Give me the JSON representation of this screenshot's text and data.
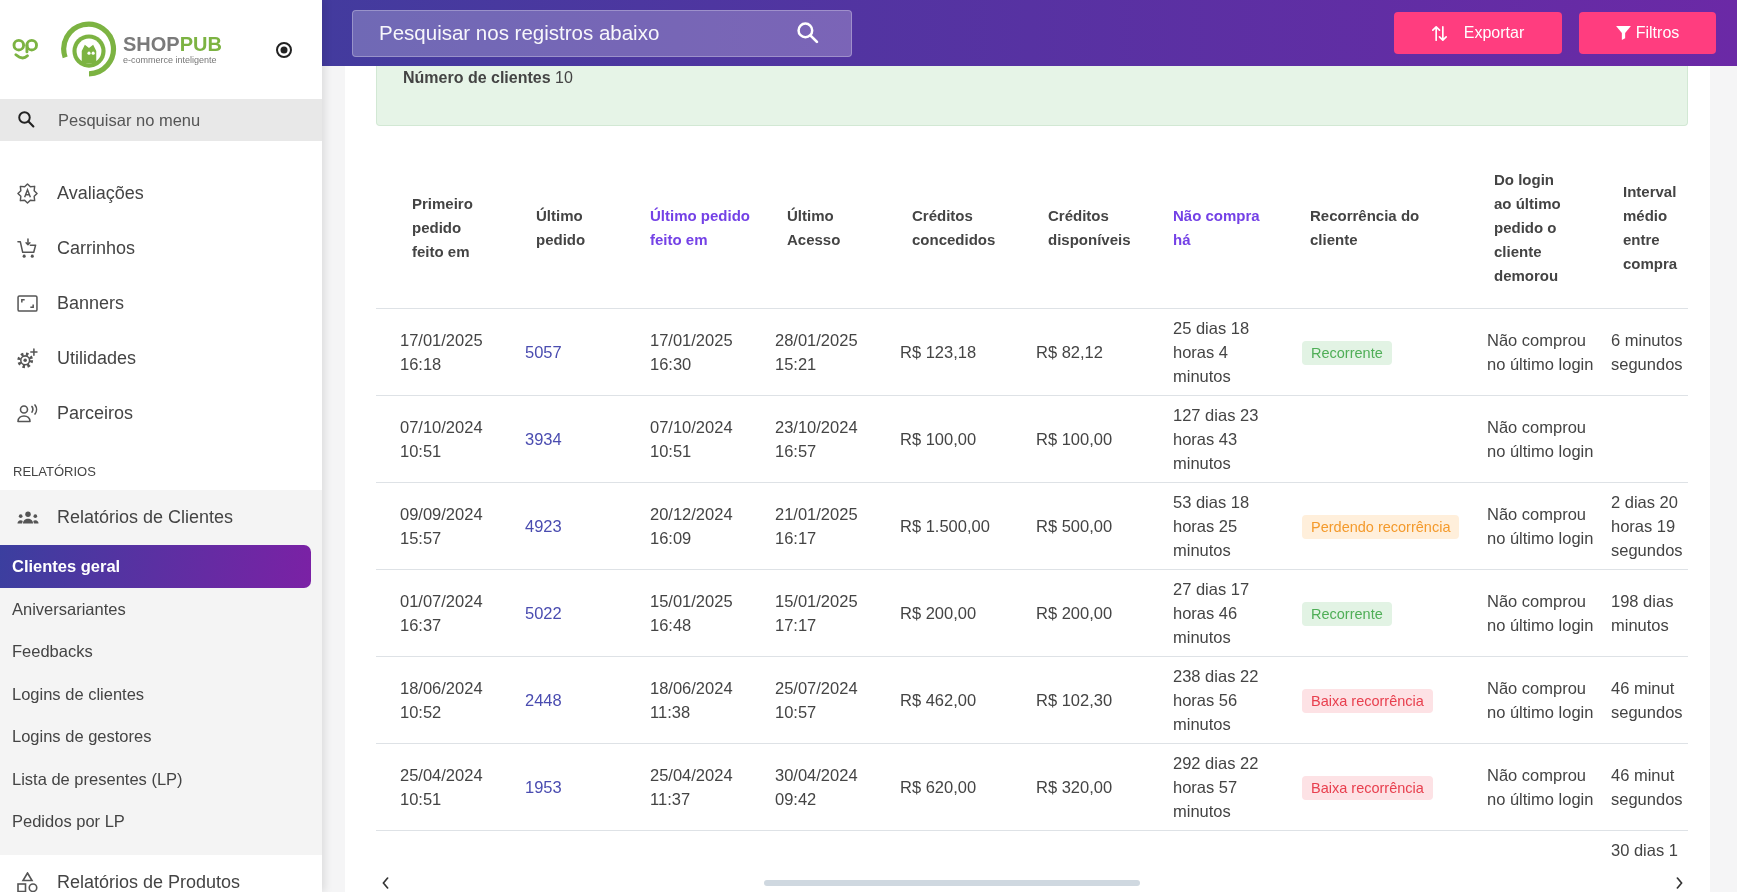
{
  "sidebar": {
    "wordmark": [
      {
        "text": "SHOP",
        "color": "#7a7a7a"
      },
      {
        "text": "PUB",
        "color": "#7cb342"
      }
    ],
    "tagline": "e-commerce inteligente",
    "search": {
      "placeholder": "Pesquisar no menu"
    },
    "items": [
      {
        "label": "Avaliações",
        "selected": false
      },
      {
        "label": "Carrinhos",
        "selected": false
      },
      {
        "label": "Banners",
        "selected": false
      },
      {
        "label": "Utilidades",
        "selected": false
      },
      {
        "label": "Parceiros",
        "selected": false
      }
    ],
    "section_title": "RELATÓRIOS",
    "groups": [
      {
        "label": "Relatórios de Clientes",
        "expanded": true,
        "children": [
          {
            "label": "Clientes geral",
            "selected": true
          },
          {
            "label": "Aniversariantes",
            "selected": false
          },
          {
            "label": "Feedbacks",
            "selected": false
          },
          {
            "label": "Logins de clientes",
            "selected": false
          },
          {
            "label": "Logins de gestores",
            "selected": false
          },
          {
            "label": "Lista de presentes (LP)",
            "selected": false
          },
          {
            "label": "Pedidos por LP",
            "selected": false
          }
        ]
      },
      {
        "label": "Relatórios de Produtos",
        "expanded": false
      }
    ]
  },
  "topbar": {
    "search": {
      "placeholder": "Pesquisar nos registros abaixo"
    },
    "buttons": [
      {
        "label": "Exportar"
      },
      {
        "label": "Filtros"
      }
    ]
  },
  "summary": "**Número de clientes** 10",
  "table": {
    "columns": [
      {
        "label": "Primeiro pedido feito em",
        "sortable": false
      },
      {
        "label": "Último pedido",
        "sortable": false
      },
      {
        "label": "Último pedido feito em",
        "sortable": true
      },
      {
        "label": "Último Acesso",
        "sortable": false
      },
      {
        "label": "Créditos concedidos",
        "sortable": false
      },
      {
        "label": "Créditos disponíveis",
        "sortable": false
      },
      {
        "label": "Não compra há",
        "sortable": true
      },
      {
        "label": "Recorrência do cliente",
        "sortable": false
      },
      {
        "label": "Do login ao último pedido o cliente demorou",
        "sortable": false
      },
      {
        "label": "Interval médio entre compra",
        "sortable": false
      }
    ],
    "rows": [
      {
        "first_order": "17/01/2025 16:18",
        "last_order": "5057",
        "last_order_date": "17/01/2025 16:30",
        "last_access": "28/01/2025 15:21",
        "credits_granted": "R$ 123,18",
        "credits_available": "R$ 82,12",
        "not_buying_for": "25 dias 18 horas 4 minutos",
        "recurrence": {
          "label": "Recorrente",
          "kind": "success"
        },
        "login_to_order": "Não comprou no último login",
        "column_10": "6 minutos segundos"
      },
      {
        "first_order": "07/10/2024 10:51",
        "last_order": "3934",
        "last_order_date": "07/10/2024 10:51",
        "last_access": "23/10/2024 16:57",
        "credits_granted": "R$ 100,00",
        "credits_available": "R$ 100,00",
        "not_buying_for": "127 dias 23 horas 43 minutos",
        "login_to_order": "Não comprou no último login"
      },
      {
        "first_order": "09/09/2024 15:57",
        "last_order": "4923",
        "last_order_date": "20/12/2024 16:09",
        "last_access": "21/01/2025 16:17",
        "credits_granted": "R$ 1.500,00",
        "credits_available": "R$ 500,00",
        "not_buying_for": "53 dias 18 horas 25 minutos",
        "recurrence": {
          "label": "Perdendo recorrência",
          "kind": "warning"
        },
        "login_to_order": "Não comprou no último login",
        "column_10": "2 dias 20 horas 19 segundos"
      },
      {
        "first_order": "01/07/2024 16:37",
        "last_order": "5022",
        "last_order_date": "15/01/2025 16:48",
        "last_access": "15/01/2025 17:17",
        "credits_granted": "R$ 200,00",
        "credits_available": "R$ 200,00",
        "not_buying_for": "27 dias 17 horas 46 minutos",
        "recurrence": {
          "label": "Recorrente",
          "kind": "success"
        },
        "login_to_order": "Não comprou no último login",
        "column_10": "198 dias minutos"
      },
      {
        "first_order": "18/06/2024 10:52",
        "last_order": "2448",
        "last_order_date": "18/06/2024 11:38",
        "last_access": "25/07/2024 10:57",
        "credits_granted": "R$ 462,00",
        "credits_available": "R$ 102,30",
        "not_buying_for": "238 dias 22 horas 56 minutos",
        "recurrence": {
          "label": "Baixa recorrência",
          "kind": "danger"
        },
        "login_to_order": "Não comprou no último login",
        "column_10": "46 minut segundos"
      },
      {
        "first_order": "25/04/2024 10:51",
        "last_order": "1953",
        "last_order_date": "25/04/2024 11:37",
        "last_access": "30/04/2024 09:42",
        "credits_granted": "R$ 620,00",
        "credits_available": "R$ 320,00",
        "not_buying_for": "292 dias 22 horas 57 minutos",
        "recurrence": {
          "label": "Baixa recorrência",
          "kind": "danger"
        },
        "login_to_order": "Não comprou no último login",
        "column_10": "46 minut segundos"
      },
      {
        "column_10": "30 dias 1"
      }
    ]
  }
}
